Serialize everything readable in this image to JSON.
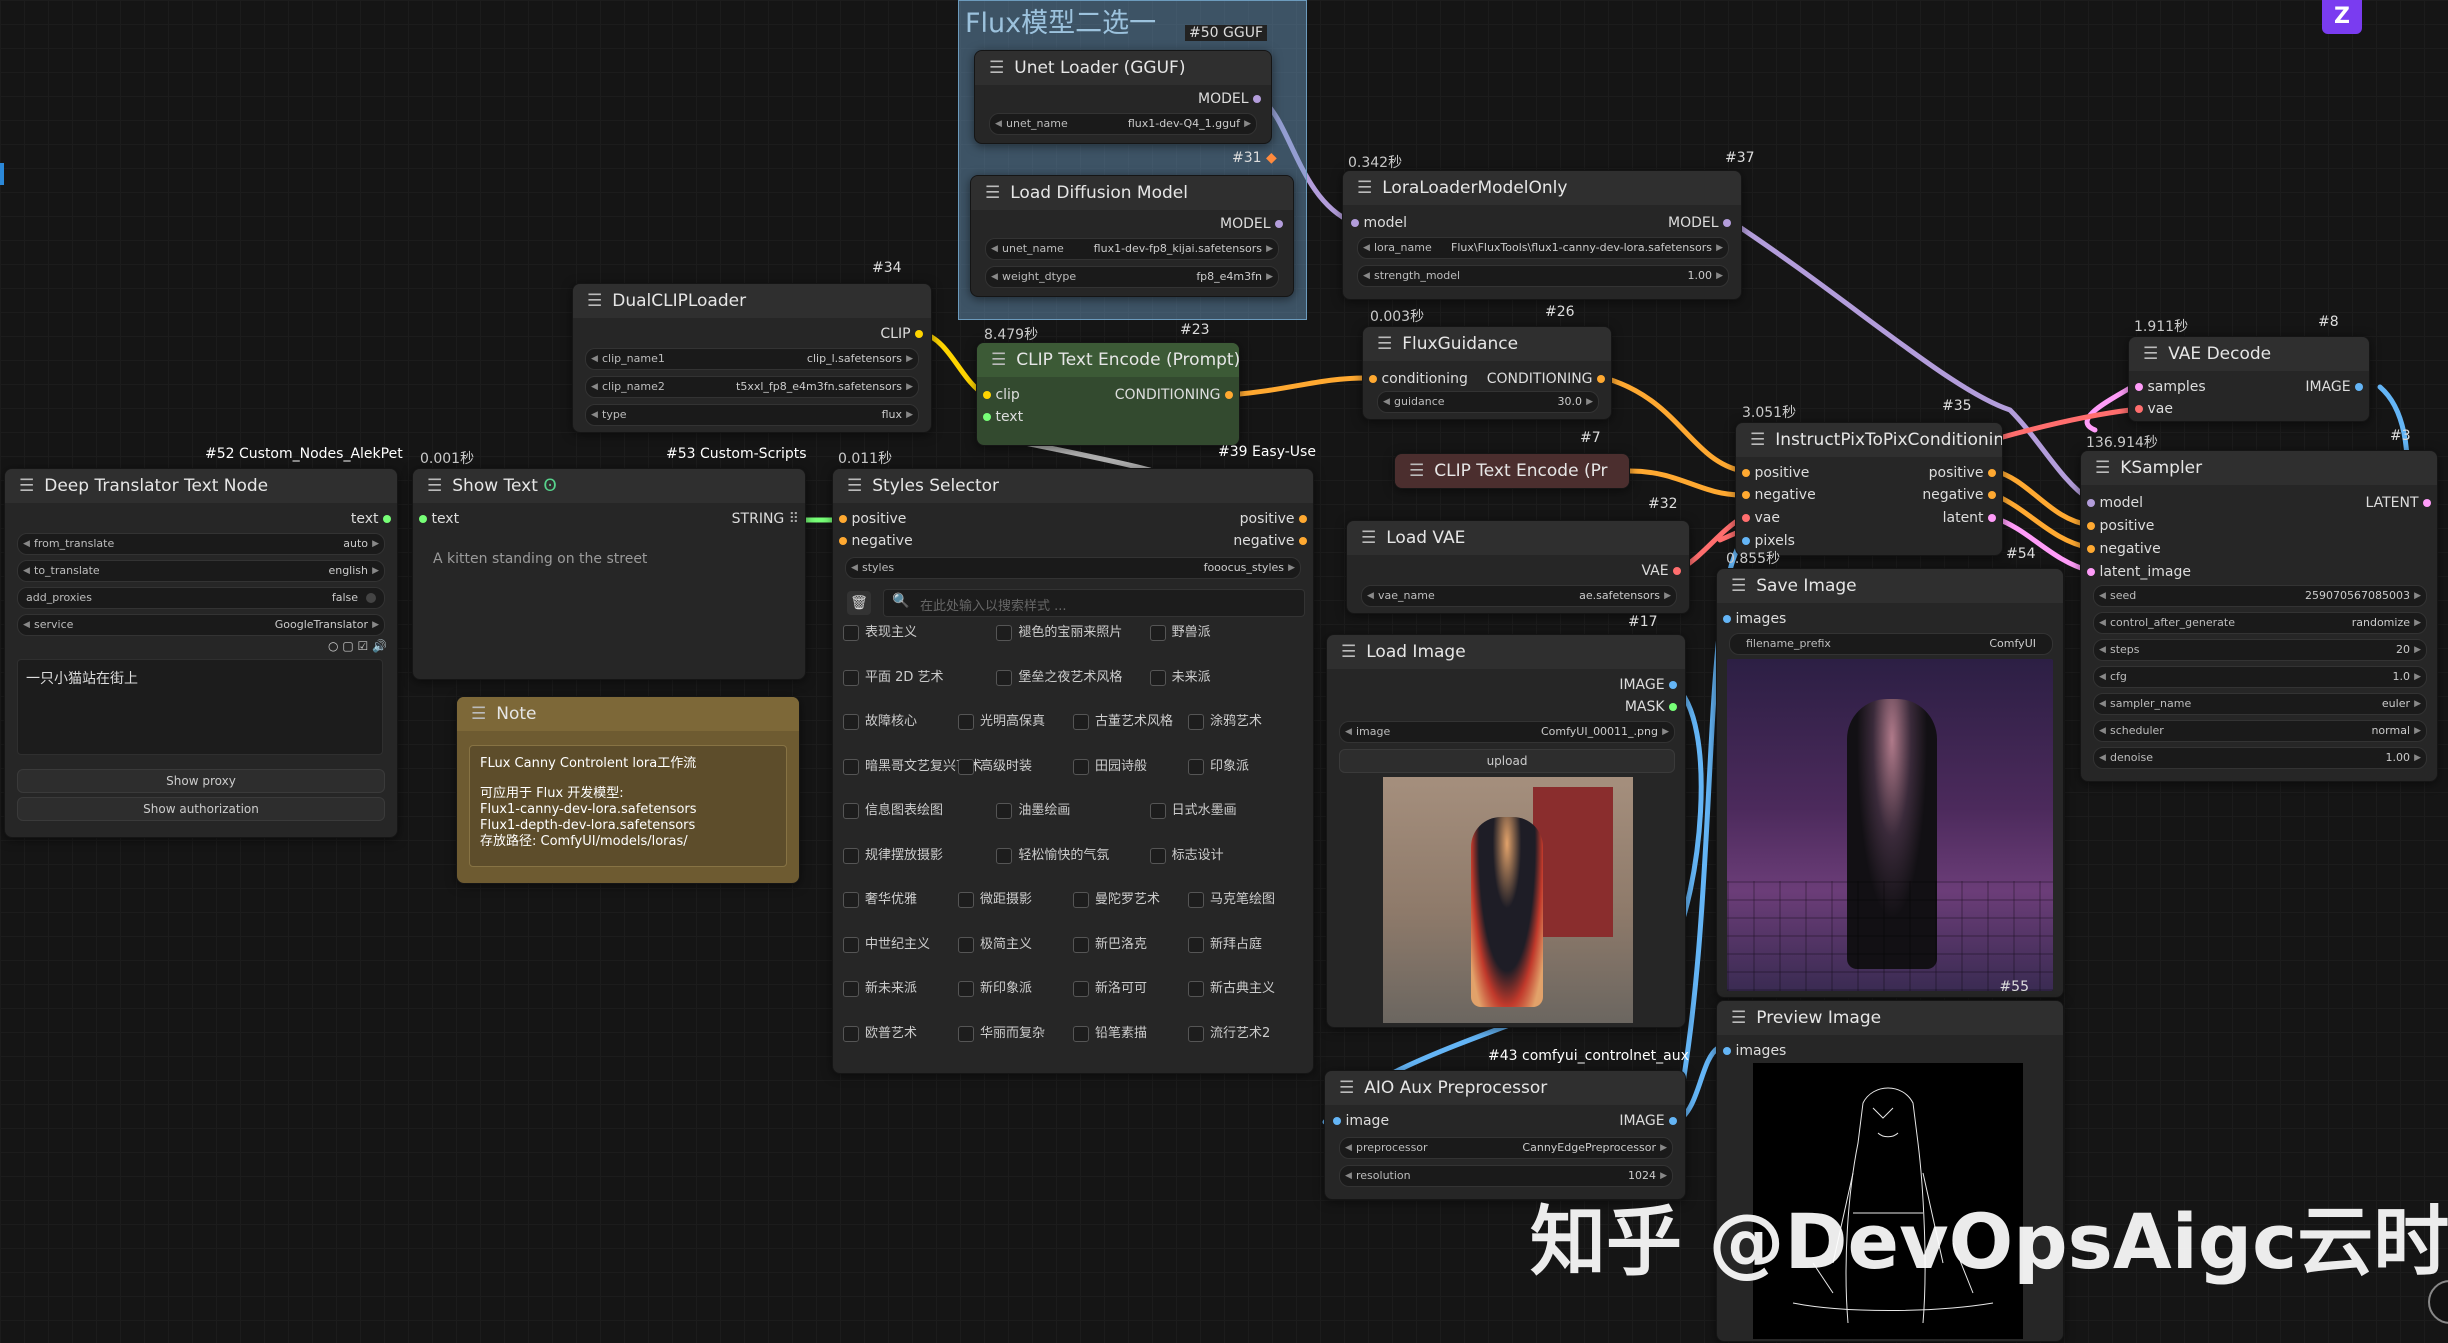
{
  "watermark": "知乎 @DevOpsAigc云时代",
  "group_flux": {
    "title": "Flux模型二选一"
  },
  "nodes": {
    "unet": {
      "badge": "#50 GGUF",
      "title": "Unet Loader (GGUF)",
      "out_model": "MODEL",
      "w_unet_label": "unet_name",
      "w_unet_value": "flux1-dev-Q4_1.gguf"
    },
    "loaddiff": {
      "badge": "#31",
      "title": "Load Diffusion Model",
      "out_model": "MODEL",
      "w_unet_label": "unet_name",
      "w_unet_value": "flux1-dev-fp8_kijai.safetensors",
      "w_dtype_label": "weight_dtype",
      "w_dtype_value": "fp8_e4m3fn"
    },
    "lora": {
      "timing": "0.342秒",
      "badge": "#37",
      "title": "LoraLoaderModelOnly",
      "in_model": "model",
      "out_model": "MODEL",
      "w_lora_label": "lora_name",
      "w_lora_value": "Flux\\FluxTools\\flux1-canny-dev-lora.safetensors",
      "w_strength_label": "strength_model",
      "w_strength_value": "1.00"
    },
    "dualclip": {
      "badge": "#34",
      "title": "DualCLIPLoader",
      "out_clip": "CLIP",
      "w1_label": "clip_name1",
      "w1_value": "clip_l.safetensors",
      "w2_label": "clip_name2",
      "w2_value": "t5xxl_fp8_e4m3fn.safetensors",
      "w3_label": "type",
      "w3_value": "flux"
    },
    "cliptext": {
      "timing": "8.479秒",
      "badge": "#23",
      "title": "CLIP Text Encode (Prompt)",
      "in_clip": "clip",
      "in_text": "text",
      "out_cond": "CONDITIONING"
    },
    "fluxguid": {
      "timing": "0.003秒",
      "badge": "#26",
      "title": "FluxGuidance",
      "in_cond": "conditioning",
      "out_cond": "CONDITIONING",
      "w_label": "guidance",
      "w_value": "30.0"
    },
    "cliptext2": {
      "badge": "#7",
      "title": "CLIP Text Encode (Pr"
    },
    "easyuse": {
      "badge": "#39 Easy-Use"
    },
    "translator": {
      "badge": "#52 Custom_Nodes_AlekPet",
      "title": "Deep Translator Text Node",
      "out_text": "text",
      "w1_label": "from_translate",
      "w1_value": "auto",
      "w2_label": "to_translate",
      "w2_value": "english",
      "w3_label": "add_proxies",
      "w3_value": "false",
      "w4_label": "service",
      "w4_value": "GoogleTranslator",
      "input_text": "一只小猫站在街上",
      "btn_proxy": "Show proxy",
      "btn_auth": "Show authorization"
    },
    "showtext": {
      "timing": "0.001秒",
      "badge": "#53 Custom-Scripts",
      "title": "Show Text",
      "in_text": "text",
      "out_string": "STRING",
      "content": "A kitten standing on the street"
    },
    "note": {
      "title": "Note",
      "line1": "FLux Canny Controlent lora工作流",
      "line2": "可应用于 Flux 开发模型:",
      "line3": "Flux1-canny-dev-lora.safetensors",
      "line4": "Flux1-depth-dev-lora.safetensors",
      "line5": "存放路径: ComfyUI/models/loras/"
    },
    "styles": {
      "timing": "0.011秒",
      "title": "Styles Selector",
      "in_pos": "positive",
      "in_neg": "negative",
      "out_pos": "positive",
      "out_neg": "negative",
      "w_label": "styles",
      "w_value": "fooocus_styles",
      "search_placeholder": "在此处输入以搜索样式 ...",
      "chips": [
        [
          "表现主义",
          "褪色的宝丽来照片",
          "野兽派"
        ],
        [
          "平面 2D 艺术",
          "堡垒之夜艺术风格",
          "未来派"
        ],
        [
          "故障核心",
          "光明高保真",
          "古董艺术风格",
          "涂鸦艺术"
        ],
        [
          "暗黑哥文艺复兴艺术",
          "高级时装",
          "田园诗般",
          "印象派"
        ],
        [
          "信息图表绘图",
          "油墨绘画",
          "日式水墨画"
        ],
        [
          "规律摆放摄影",
          "轻松愉快的气氛",
          "标志设计"
        ],
        [
          "奢华优雅",
          "微距摄影",
          "曼陀罗艺术",
          "马克笔绘图"
        ],
        [
          "中世纪主义",
          "极简主义",
          "新巴洛克",
          "新拜占庭"
        ],
        [
          "新未来派",
          "新印象派",
          "新洛可可",
          "新古典主义"
        ],
        [
          "欧普艺术",
          "华丽而复杂",
          "铅笔素描",
          "流行艺术2"
        ]
      ]
    },
    "instructpix": {
      "timing": "3.051秒",
      "badge": "#35",
      "title": "InstructPixToPixConditioning",
      "in_pos": "positive",
      "in_neg": "negative",
      "in_vae": "vae",
      "in_pixels": "pixels",
      "out_pos": "positive",
      "out_neg": "negative",
      "out_latent": "latent"
    },
    "loadvae": {
      "badge": "#32",
      "title": "Load VAE",
      "out_vae": "VAE",
      "w_label": "vae_name",
      "w_value": "ae.safetensors"
    },
    "saveimage": {
      "timing": "0.855秒",
      "badge": "#54",
      "title": "Save Image",
      "in_images": "images",
      "w_label": "filename_prefix",
      "w_value": "ComfyUI",
      "badge2": "#55"
    },
    "loadimage": {
      "badge": "#17",
      "title": "Load Image",
      "out_image": "IMAGE",
      "out_mask": "MASK",
      "w_label": "image",
      "w_value": "ComfyUI_00011_.png",
      "upload": "upload"
    },
    "previewimage": {
      "title": "Preview Image",
      "in_images": "images"
    },
    "aio": {
      "badge": "#43 comfyui_controlnet_aux",
      "title": "AIO Aux Preprocessor",
      "in_image": "image",
      "out_image": "IMAGE",
      "w1_label": "preprocessor",
      "w1_value": "CannyEdgePreprocessor",
      "w2_label": "resolution",
      "w2_value": "1024"
    },
    "vaedecode": {
      "timing": "1.911秒",
      "badge": "#8",
      "title": "VAE Decode",
      "in_samples": "samples",
      "in_vae": "vae",
      "out_image": "IMAGE"
    },
    "ksampler": {
      "timing": "136.914秒",
      "badge": "#3",
      "title": "KSampler",
      "in_model": "model",
      "in_pos": "positive",
      "in_neg": "negative",
      "in_latent": "latent_image",
      "out_latent": "LATENT",
      "w_seed_label": "seed",
      "w_seed_value": "259070567085003",
      "w_ctrl_label": "control_after_generate",
      "w_ctrl_value": "randomize",
      "w_steps_label": "steps",
      "w_steps_value": "20",
      "w_cfg_label": "cfg",
      "w_cfg_value": "1.0",
      "w_sampler_label": "sampler_name",
      "w_sampler_value": "euler",
      "w_sched_label": "scheduler",
      "w_sched_value": "normal",
      "w_denoise_label": "denoise",
      "w_denoise_value": "1.00"
    }
  },
  "colors": {
    "model": "#b39ddb",
    "clip": "#ffd500",
    "cond": "#ffa931",
    "vae": "#ff6e6e",
    "image": "#64b5f6",
    "latent": "#ff9cf9",
    "string": "#77ff77"
  }
}
